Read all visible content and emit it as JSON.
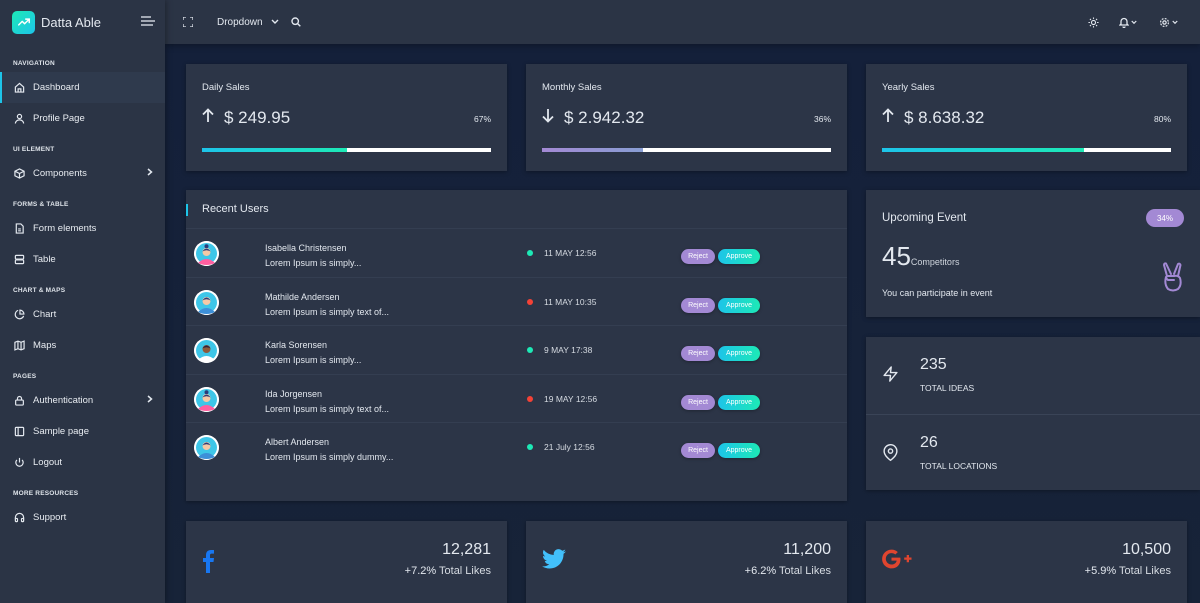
{
  "brand": {
    "name": "Datta Able"
  },
  "header": {
    "dropdown_label": "Dropdown",
    "icons": [
      "fullscreen-icon",
      "search-icon",
      "sun-icon",
      "bell-icon",
      "settings-icon"
    ]
  },
  "sidebar": {
    "sections": [
      {
        "caption": "NAVIGATION",
        "items": [
          {
            "label": "Dashboard",
            "icon": "home-icon",
            "active": true
          },
          {
            "label": "Profile Page",
            "icon": "user-icon"
          }
        ]
      },
      {
        "caption": "UI ELEMENT",
        "items": [
          {
            "label": "Components",
            "icon": "box-icon",
            "has_children": true
          }
        ]
      },
      {
        "caption": "FORMS & TABLE",
        "items": [
          {
            "label": "Form elements",
            "icon": "file-icon"
          },
          {
            "label": "Table",
            "icon": "server-icon"
          }
        ]
      },
      {
        "caption": "CHART & MAPS",
        "items": [
          {
            "label": "Chart",
            "icon": "pie-chart-icon"
          },
          {
            "label": "Maps",
            "icon": "map-icon"
          }
        ]
      },
      {
        "caption": "PAGES",
        "items": [
          {
            "label": "Authentication",
            "icon": "lock-icon",
            "has_children": true
          },
          {
            "label": "Sample page",
            "icon": "sidebar-icon"
          },
          {
            "label": "Logout",
            "icon": "power-icon"
          }
        ]
      },
      {
        "caption": "MORE RESOURCES",
        "items": [
          {
            "label": "Support",
            "icon": "headphones-icon"
          }
        ]
      }
    ]
  },
  "sales": [
    {
      "title": "Daily Sales",
      "amount": "$ 249.95",
      "direction": "up",
      "percent_label": "67%",
      "progress": 0.5,
      "bar_color": "linear-gradient(90deg,#1dc4e9,#1de9b6)"
    },
    {
      "title": "Monthly Sales",
      "amount": "$ 2.942.32",
      "direction": "down",
      "percent_label": "36%",
      "progress": 0.35,
      "bar_color": "linear-gradient(90deg,#a389d4,#899ed4)"
    },
    {
      "title": "Yearly Sales",
      "amount": "$ 8.638.32",
      "direction": "up",
      "percent_label": "80%",
      "progress": 0.7,
      "bar_color": "linear-gradient(90deg,#1dc4e9,#1de9b6)"
    }
  ],
  "recent_users": {
    "title": "Recent Users",
    "reject_label": "Reject",
    "approve_label": "Approve",
    "rows": [
      {
        "name": "Isabella Christensen",
        "message": "Lorem Ipsum is simply...",
        "date": "11 MAY 12:56",
        "status": "green",
        "avatar": "female"
      },
      {
        "name": "Mathilde Andersen",
        "message": "Lorem Ipsum is simply text of...",
        "date": "11 MAY 10:35",
        "status": "red",
        "avatar": "male"
      },
      {
        "name": "Karla Sorensen",
        "message": "Lorem Ipsum is simply...",
        "date": "9 MAY 17:38",
        "status": "green",
        "avatar": "female-dark"
      },
      {
        "name": "Ida Jorgensen",
        "message": "Lorem Ipsum is simply text of...",
        "date": "19 MAY 12:56",
        "status": "red",
        "avatar": "female"
      },
      {
        "name": "Albert Andersen",
        "message": "Lorem Ipsum is simply dummy...",
        "date": "21 July 12:56",
        "status": "green",
        "avatar": "male"
      }
    ]
  },
  "event": {
    "title": "Upcoming Event",
    "badge": "34%",
    "count": "45",
    "count_label": "Competitors",
    "subtitle": "You can participate in event",
    "icon": "peace-hand-icon"
  },
  "stats": [
    {
      "value": "235",
      "label": "TOTAL IDEAS",
      "icon": "zap-icon"
    },
    {
      "value": "26",
      "label": "TOTAL LOCATIONS",
      "icon": "map-pin-icon"
    }
  ],
  "social": [
    {
      "network": "facebook",
      "icon": "facebook-icon",
      "value": "12,281",
      "change": "+7.2%",
      "label": "Total Likes",
      "color": "#3b5998"
    },
    {
      "network": "twitter",
      "icon": "twitter-icon",
      "value": "11,200",
      "change": "+6.2%",
      "label": "Total Likes",
      "color": "#42c0fb"
    },
    {
      "network": "google-plus",
      "icon": "google-plus-icon",
      "value": "10,500",
      "change": "+5.9%",
      "label": "Total Likes",
      "color": "#e0452f"
    }
  ],
  "colors": {
    "accent_cyan": "#1dc4e9",
    "accent_green": "#1de9b6",
    "accent_purple": "#a389d4",
    "status_green": "#1de9b6",
    "status_red": "#f44236"
  }
}
